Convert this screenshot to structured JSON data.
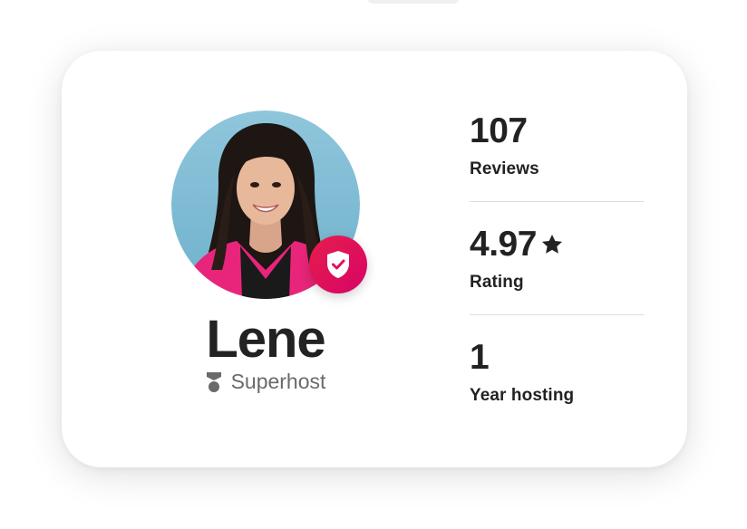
{
  "host": {
    "name": "Lene",
    "badge_label": "Superhost"
  },
  "stats": [
    {
      "value": "107",
      "label": "Reviews"
    },
    {
      "value": "4.97",
      "label": "Rating",
      "icon": "star-icon"
    },
    {
      "value": "1",
      "label": "Year hosting"
    }
  ],
  "colors": {
    "brand_gradient_start": "#e61e4d",
    "brand_gradient_end": "#d70466",
    "text_primary": "#222222",
    "text_secondary": "#6a6a6a",
    "divider": "#dddddd"
  }
}
